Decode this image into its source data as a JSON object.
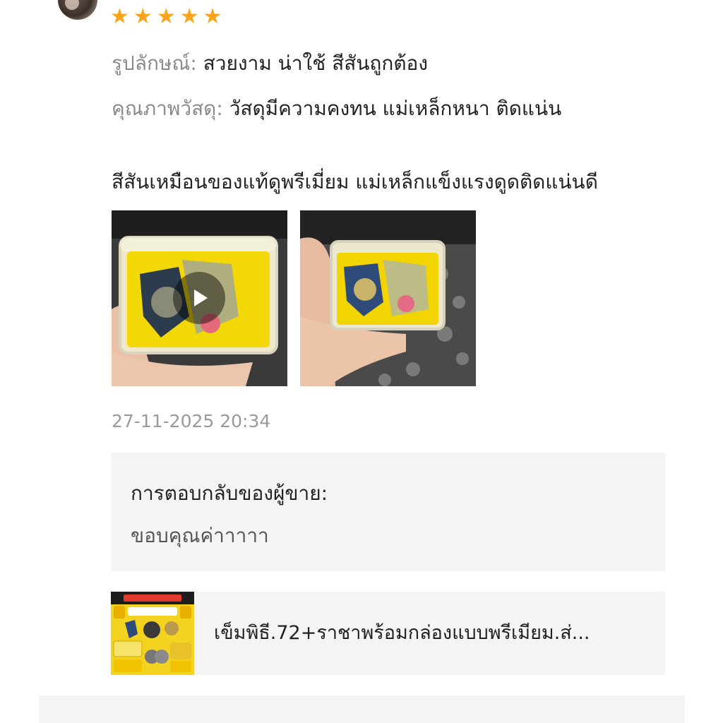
{
  "review": {
    "rating": 5,
    "stars": [
      "★",
      "★",
      "★",
      "★",
      "★"
    ],
    "attributes": [
      {
        "key": "รูปลักษณ์:",
        "value": "สวยงาม น่าใช้ สีสันถูกต้อง"
      },
      {
        "key": "คุณภาพวัสดุ:",
        "value": "วัสดุมีความคงทน แม่เหล็กหนา ติดแน่น"
      }
    ],
    "comment": "สีสันเหมือนของแท้ดูพรีเมี่ยม แม่เหล็กแข็งแรงดูดติดแน่นดี",
    "timestamp": "27-11-2025 20:34"
  },
  "seller_reply": {
    "title": "การตอบกลับของผู้ขาย:",
    "text": "ขอบคุณค่าาาาา"
  },
  "product": {
    "name": "เข็มพิธี.72+ราชาพร้อมกล่องแบบพรีเมียม.ส่..."
  },
  "colors": {
    "star": "#f9a41a",
    "label_gray": "#8a8a8a",
    "card_bg": "#f4f4f4"
  }
}
